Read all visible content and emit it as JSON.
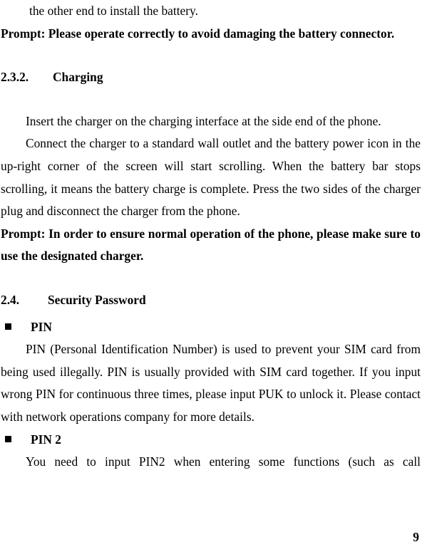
{
  "document": {
    "page_number": "9",
    "blocks": {
      "continued_line": "the other end to install the battery.",
      "prompt_battery": "Prompt: Please operate correctly to avoid damaging the battery connector.",
      "heading_232_number": "2.3.2.",
      "heading_232_title": "Charging",
      "para_insert_charger": "Insert the charger on the charging interface at the side end of the phone.",
      "para_connect_charger": "Connect the charger to a standard wall outlet and the battery power icon in the up-right corner of the screen will start scrolling. When the battery bar stops scrolling, it means the battery charge is complete. Press the two sides of the charger plug and disconnect the charger from the phone.",
      "prompt_charger": "Prompt: In order to ensure normal operation of the phone, please make sure to use the designated charger.",
      "heading_24_number": "2.4.",
      "heading_24_title": "Security Password",
      "bullet_pin_label": "PIN",
      "para_pin": "PIN (Personal Identification Number) is used to prevent your SIM card from being used illegally. PIN is usually provided with SIM card together. If you input wrong PIN for continuous three times, please input PUK to unlock it. Please contact with network operations company for more details.",
      "bullet_pin2_label": "PIN 2",
      "para_pin2": "You need to input PIN2 when entering some functions (such as call"
    }
  }
}
